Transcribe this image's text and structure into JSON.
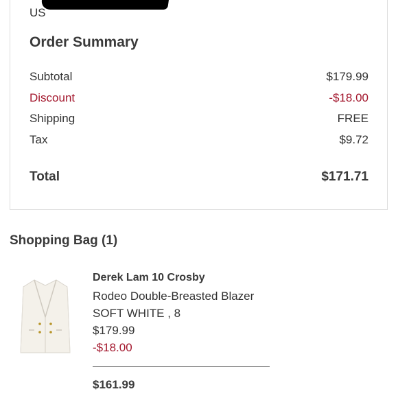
{
  "address": {
    "country": "US"
  },
  "order_summary": {
    "title": "Order Summary",
    "subtotal_label": "Subtotal",
    "subtotal_value": "$179.99",
    "discount_label": "Discount",
    "discount_value": "-$18.00",
    "shipping_label": "Shipping",
    "shipping_value": "FREE",
    "tax_label": "Tax",
    "tax_value": "$9.72",
    "total_label": "Total",
    "total_value": "$171.71"
  },
  "shopping_bag": {
    "title": "Shopping Bag (1)",
    "item": {
      "brand": "Derek Lam 10 Crosby",
      "name": "Rodeo Double-Breasted Blazer",
      "variant": "SOFT WHITE , 8",
      "price": "$179.99",
      "discount": "-$18.00",
      "final_price": "$161.99"
    }
  },
  "colors": {
    "accent_red": "#a3172d",
    "text": "#333333",
    "border": "#dcdcdc"
  }
}
